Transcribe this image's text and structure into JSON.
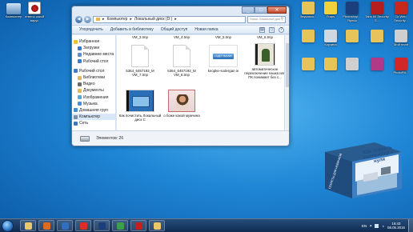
{
  "desktop": {
    "left_icons": [
      {
        "label": "Компьютер",
        "icon": "computer-icon"
      },
      {
        "label": "ответы какой вирус",
        "icon": "video-file-icon"
      }
    ],
    "right_icons": [
      {
        "label": "Звуковая...",
        "icon": "folder-icon",
        "color": "#e6c45a"
      },
      {
        "label": "Fraps",
        "icon": "fraps-icon",
        "color": "#f2d23a"
      },
      {
        "label": "Photoshop ... Ярлык",
        "icon": "photoshop-icon",
        "color": "#1b3f7c"
      },
      {
        "label": "Tabs 60 Security S...",
        "icon": "security-icon",
        "color": "#b51e1e"
      },
      {
        "label": "Dr.Web Security...",
        "icon": "shield-icon",
        "color": "#c8281c"
      },
      {
        "label": "",
        "icon": "folder-icon",
        "color": "#e6c45a"
      },
      {
        "label": "Корзина",
        "icon": "recycle-bin-icon",
        "color": "#cfd8e0"
      },
      {
        "label": "",
        "icon": "folder-icon",
        "color": "#e6c45a"
      },
      {
        "label": "",
        "icon": "folder-icon",
        "color": "#e6c45a"
      },
      {
        "label": "Мой план",
        "icon": "document-icon",
        "color": "#cfcfcf"
      },
      {
        "label": "",
        "icon": "document-icon",
        "color": "#e6c45a"
      },
      {
        "label": "",
        "icon": "folder-icon",
        "color": "#e6c45a"
      },
      {
        "label": "",
        "icon": "document-icon",
        "color": "#cfcfcf"
      },
      {
        "label": "",
        "icon": "archive-icon",
        "color": "#b03a8a"
      },
      {
        "label": "PhotoFilt...",
        "icon": "photofilter-icon",
        "color": "#d12727"
      }
    ]
  },
  "window": {
    "address": [
      "Компьютер",
      "Локальный диск (D:)"
    ],
    "search_placeholder": "Поиск: Локальный диск (D:)",
    "toolbar": {
      "organize": "Упорядочить",
      "add_to_library": "Добавить в библиотеку",
      "share": "Общий доступ",
      "new_folder": "Новая папка"
    },
    "nav": [
      {
        "label": "Избранное",
        "icon": "star-icon",
        "color": "#f0c23a"
      },
      {
        "label": "Загрузки",
        "icon": "downloads-icon",
        "color": "#3a78c7"
      },
      {
        "label": "Недавние места",
        "icon": "recent-icon",
        "color": "#5f8fc9"
      },
      {
        "label": "Рабочий стол",
        "icon": "desktop-icon",
        "color": "#3f7dcb"
      },
      {
        "label": "",
        "icon": "",
        "color": ""
      },
      {
        "label": "Рабочий стол",
        "icon": "desktop-icon",
        "color": "#3f7dcb"
      },
      {
        "label": "Библиотеки",
        "icon": "libraries-icon",
        "color": "#e2b84f"
      },
      {
        "label": "Видео",
        "icon": "video-icon",
        "color": "#6b6b6b"
      },
      {
        "label": "Документы",
        "icon": "documents-icon",
        "color": "#e2b84f"
      },
      {
        "label": "Изображения",
        "icon": "images-icon",
        "color": "#5aa5de"
      },
      {
        "label": "Музыка",
        "icon": "music-icon",
        "color": "#4c8fd6"
      },
      {
        "label": "Домашняя груп",
        "icon": "homegroup-icon",
        "color": "#3e8fd8"
      },
      {
        "label": "Компьютер",
        "icon": "computer-icon",
        "color": "#7b8ea6"
      },
      {
        "label": "Сеть",
        "icon": "network-icon",
        "color": "#3b79bd"
      }
    ],
    "files_top_row": [
      {
        "name": "VM_3.tmp"
      },
      {
        "name": "VM_4.tmp"
      },
      {
        "name": "VM_5.tmp"
      },
      {
        "name": "VM_6.tmp"
      }
    ],
    "files_mid_row": [
      {
        "name": "5364_6457193_M VM_7.tmp",
        "type": "doc"
      },
      {
        "name": "5364_6457193_M VM_8.tmp",
        "type": "doc"
      },
      {
        "name": "knopke-sodergan ie",
        "type": "button",
        "thumb_text": "СОДЕРЖАНИЕ"
      },
      {
        "name": "автоматическое переключение языка или ПК понимает без с...",
        "type": "video"
      }
    ],
    "files_bottom_row": [
      {
        "name": "Как почистить Локальный диск С",
        "type": "video2"
      },
      {
        "name": "о боже какой мужчина",
        "type": "image"
      }
    ],
    "status": "Элементов: 26"
  },
  "book": {
    "title": "Как освоить компьютер с нуля",
    "spine": "СЕКРЕТЫ ДЛЯ НОВИЧКОВ"
  },
  "taskbar": {
    "apps": [
      {
        "icon": "explorer-icon",
        "color": "#e8c86a"
      },
      {
        "icon": "firefox-icon",
        "color": "#e06a1c"
      },
      {
        "icon": "media-player-icon",
        "color": "#2f6fbf"
      },
      {
        "icon": "yandex-icon",
        "color": "#e02b2b"
      },
      {
        "icon": "photoshop-icon",
        "color": "#1b3f7c"
      },
      {
        "icon": "chrome-icon",
        "color": "#3aa04a"
      },
      {
        "icon": "opera-icon",
        "color": "#c21f1f"
      },
      {
        "icon": "explorer-window-icon",
        "color": "#e8c86a"
      }
    ],
    "lang": "EN",
    "time": "16:43",
    "date": "08.05.2015"
  }
}
